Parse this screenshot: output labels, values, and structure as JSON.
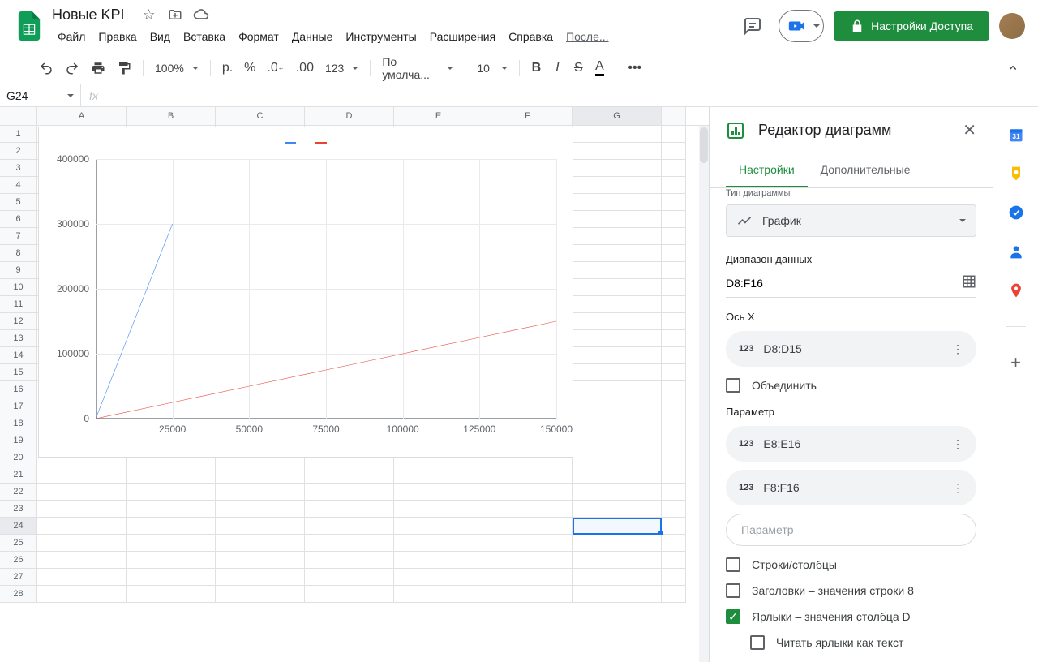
{
  "doc": {
    "title": "Новые KPI"
  },
  "menu": [
    "Файл",
    "Правка",
    "Вид",
    "Вставка",
    "Формат",
    "Данные",
    "Инструменты",
    "Расширения",
    "Справка"
  ],
  "menu_last": "После...",
  "share_label": "Настройки Доступа",
  "toolbar": {
    "zoom": "100%",
    "font_default": "По умолча...",
    "font_size": "10"
  },
  "name_box": "G24",
  "columns": [
    "A",
    "B",
    "C",
    "D",
    "E",
    "F",
    "G"
  ],
  "selected_col_index": 6,
  "selected_row": 24,
  "row_count": 28,
  "chart_data": {
    "type": "line",
    "x": [
      0,
      25000,
      50000,
      75000,
      100000,
      125000,
      150000
    ],
    "series": [
      {
        "name": "",
        "color": "#4285f4",
        "values": [
          0,
          300000,
          null,
          null,
          null,
          null,
          null
        ]
      },
      {
        "name": "",
        "color": "#ea4335",
        "values": [
          0,
          25000,
          50000,
          75000,
          100000,
          125000,
          150000
        ]
      }
    ],
    "xlabel": "",
    "ylabel": "",
    "xlim": [
      0,
      150000
    ],
    "ylim": [
      0,
      400000
    ],
    "yticks": [
      0,
      100000,
      200000,
      300000,
      400000
    ],
    "xticks": [
      25000,
      50000,
      75000,
      100000,
      125000,
      150000
    ]
  },
  "side_panel": {
    "title": "Редактор диаграмм",
    "tabs": [
      "Настройки",
      "Дополнительные"
    ],
    "active_tab": 0,
    "chart_type_label": "Тип диаграммы",
    "chart_type": "График",
    "data_range_label": "Диапазон данных",
    "data_range": "D8:F16",
    "xaxis_label": "Ось X",
    "xaxis_range": "D8:D15",
    "combine_label": "Объединить",
    "series_label": "Параметр",
    "series": [
      "E8:E16",
      "F8:F16"
    ],
    "add_series_placeholder": "Параметр",
    "checkboxes": [
      {
        "label": "Строки/столбцы",
        "checked": false
      },
      {
        "label": "Заголовки – значения строки 8",
        "checked": false
      },
      {
        "label": "Ярлыки – значения столбца D",
        "checked": true
      },
      {
        "label": "Читать ярлыки как текст",
        "checked": false,
        "indent": true
      }
    ]
  }
}
